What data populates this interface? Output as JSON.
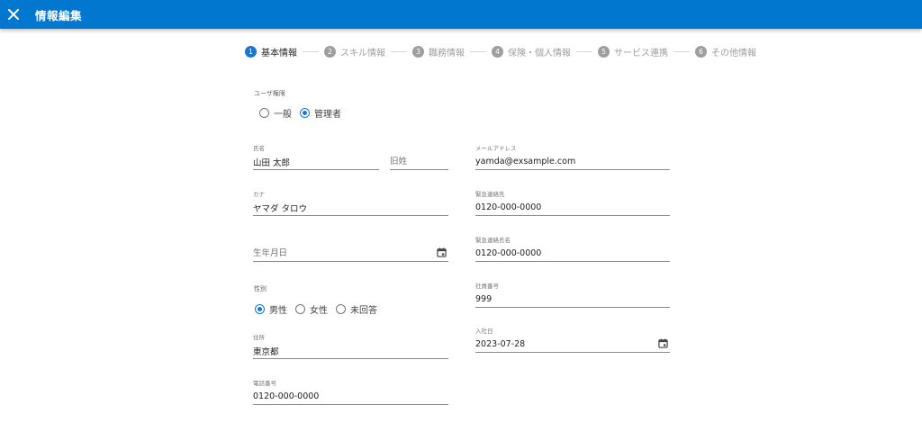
{
  "header": {
    "title": "情報編集",
    "close_icon": "close-icon"
  },
  "steps": [
    {
      "num": "1",
      "label": "基本情報",
      "active": true
    },
    {
      "num": "2",
      "label": "スキル情報"
    },
    {
      "num": "3",
      "label": "職務情報"
    },
    {
      "num": "4",
      "label": "保険・個人情報"
    },
    {
      "num": "5",
      "label": "サービス連携"
    },
    {
      "num": "6",
      "label": "その他情報"
    }
  ],
  "user_permission": {
    "label": "ユーザ権限",
    "options": [
      "一般",
      "管理者"
    ],
    "selected": "管理者"
  },
  "name": {
    "label": "氏名",
    "value": "山田 太郎"
  },
  "maiden_name": {
    "placeholder": "旧姓",
    "value": ""
  },
  "email": {
    "label": "メールアドレス",
    "value": "yamda@exsample.com"
  },
  "kana": {
    "label": "カナ",
    "value": "ヤマダ タロウ"
  },
  "emergency_contact": {
    "label": "緊急連絡先",
    "value": "0120-000-0000"
  },
  "birthday": {
    "placeholder": "生年月日",
    "value": ""
  },
  "emergency_contact_name": {
    "label": "緊急連絡氏名",
    "value": "0120-000-0000"
  },
  "gender": {
    "label": "性別",
    "options": [
      "男性",
      "女性",
      "未回答"
    ],
    "selected": "男性"
  },
  "employee_number": {
    "label": "社員番号",
    "value": "999"
  },
  "address": {
    "label": "住所",
    "value": "東京都"
  },
  "join_date": {
    "label": "入社日",
    "value": "2023-07-28"
  },
  "phone": {
    "label": "電話番号",
    "value": "0120-000-0000"
  },
  "colors": {
    "primary": "#0277d0",
    "accent": "#1976d2",
    "inactive": "#9e9e9e"
  }
}
